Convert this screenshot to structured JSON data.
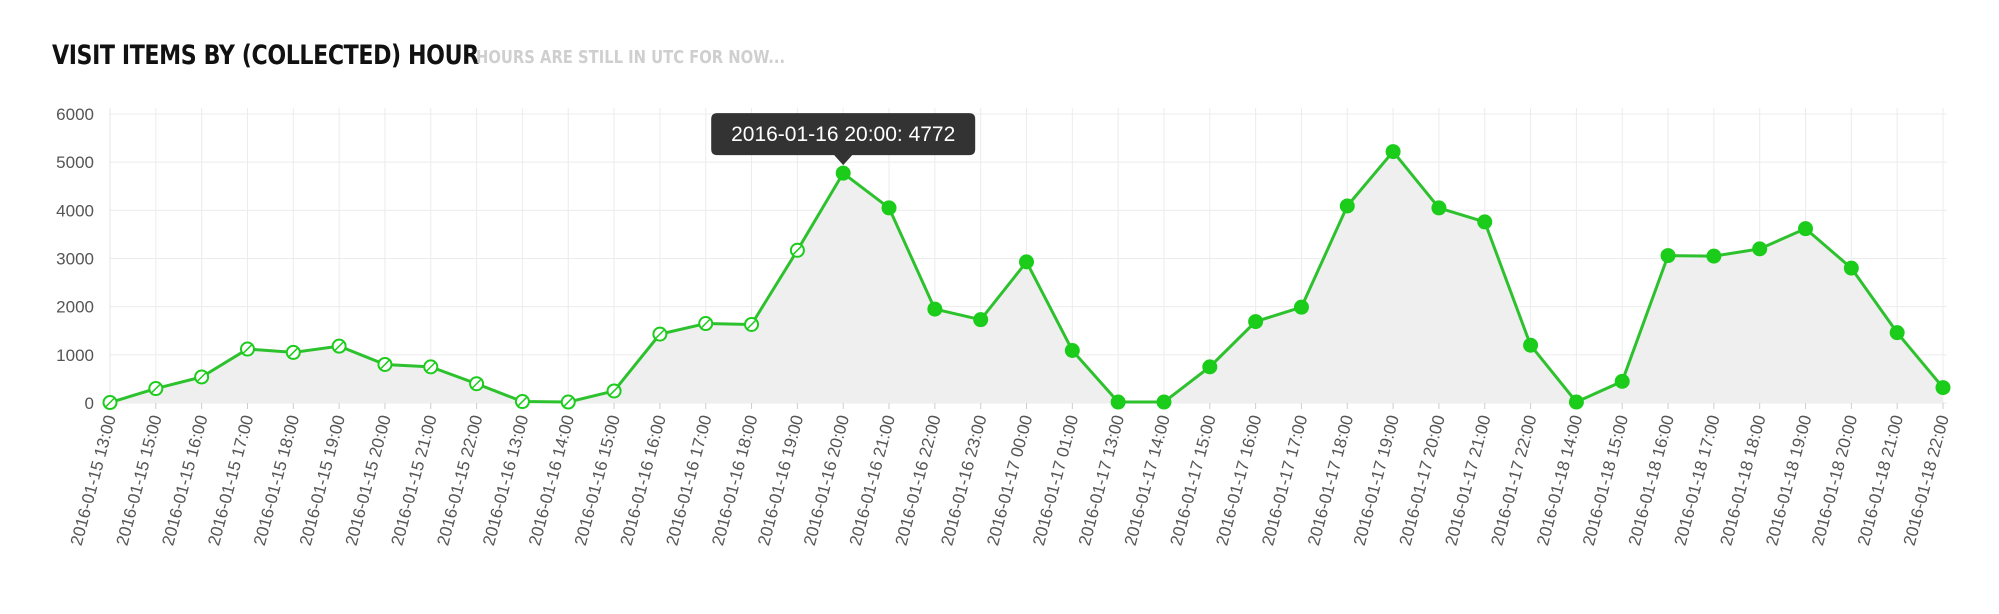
{
  "header": {
    "title": "VISIT ITEMS BY (COLLECTED) HOUR",
    "subtitle": "HOURS ARE STILL IN UTC FOR NOW..."
  },
  "tooltip": {
    "text": "2016-01-16 20:00: 4772"
  },
  "colors": {
    "line": "#2dc22d",
    "marker": "#1bcc1b",
    "area": "#efefef",
    "grid": "#ececec",
    "tooltip_bg": "#333333"
  },
  "chart_data": {
    "type": "line",
    "title": "VISIT ITEMS BY (COLLECTED) HOUR",
    "subtitle": "HOURS ARE STILL IN UTC FOR NOW...",
    "xlabel": "",
    "ylabel": "",
    "ylim": [
      0,
      6000
    ],
    "yticks": [
      "0",
      "1000",
      "2000",
      "3000",
      "4000",
      "5000",
      "6000"
    ],
    "grid": true,
    "area_fill": true,
    "x": [
      "2016-01-15 13:00",
      "2016-01-15 15:00",
      "2016-01-15 16:00",
      "2016-01-15 17:00",
      "2016-01-15 18:00",
      "2016-01-15 19:00",
      "2016-01-15 20:00",
      "2016-01-15 21:00",
      "2016-01-15 22:00",
      "2016-01-16 13:00",
      "2016-01-16 14:00",
      "2016-01-16 15:00",
      "2016-01-16 16:00",
      "2016-01-16 17:00",
      "2016-01-16 18:00",
      "2016-01-16 19:00",
      "2016-01-16 20:00",
      "2016-01-16 21:00",
      "2016-01-16 22:00",
      "2016-01-16 23:00",
      "2016-01-17 00:00",
      "2016-01-17 01:00",
      "2016-01-17 13:00",
      "2016-01-17 14:00",
      "2016-01-17 15:00",
      "2016-01-17 16:00",
      "2016-01-17 17:00",
      "2016-01-17 18:00",
      "2016-01-17 19:00",
      "2016-01-17 20:00",
      "2016-01-17 21:00",
      "2016-01-17 22:00",
      "2016-01-18 14:00",
      "2016-01-18 15:00",
      "2016-01-18 16:00",
      "2016-01-18 17:00",
      "2016-01-18 18:00",
      "2016-01-18 19:00",
      "2016-01-18 20:00",
      "2016-01-18 21:00",
      "2016-01-18 22:00"
    ],
    "series": [
      {
        "values": [
          10,
          300,
          540,
          1120,
          1050,
          1180,
          800,
          750,
          400,
          30,
          20,
          250,
          1430,
          1650,
          1630,
          3170,
          4772,
          4050,
          1950,
          1730,
          2930,
          1090,
          20,
          20,
          750,
          1690,
          1990,
          4090,
          5220,
          4050,
          3760,
          1200,
          20,
          450,
          3060,
          3050,
          3200,
          3620,
          2800,
          1460,
          320
        ],
        "hollow_markers_through": "2016-01-16 19:00"
      }
    ],
    "highlighted_point": "2016-01-16 20:00"
  }
}
